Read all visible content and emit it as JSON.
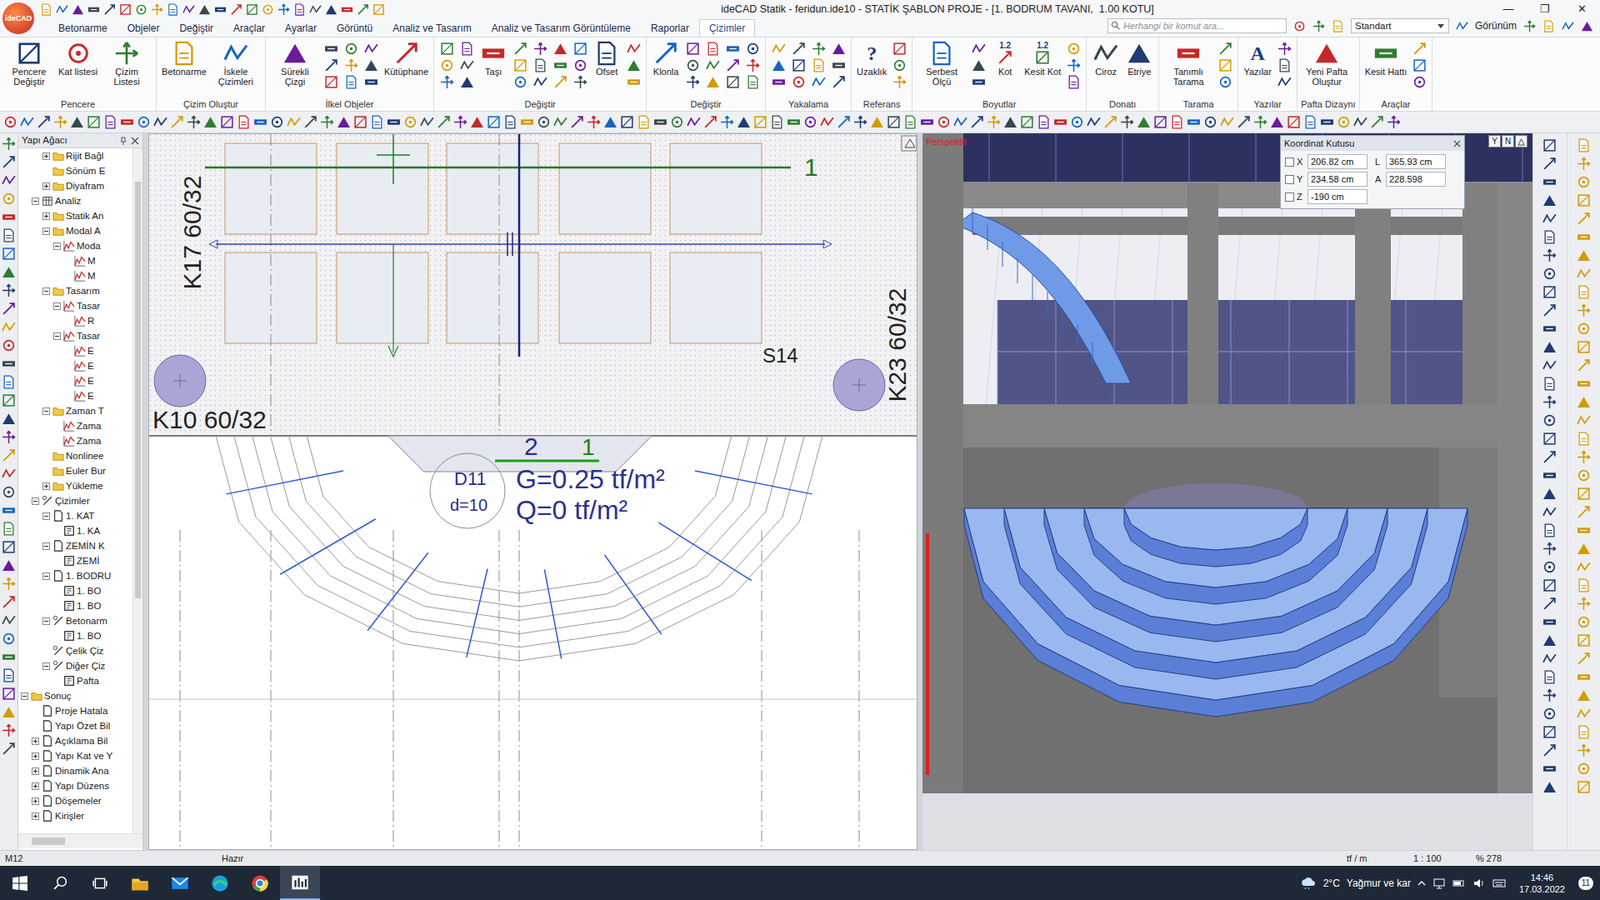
{
  "window": {
    "title": "ideCAD Statik - feridun.ide10 - STATİK ŞABLON PROJE - [1. BODRUM TAVANI,  1.00 KOTU]",
    "logo": "ideCAD",
    "controls": [
      "—",
      "❐",
      "✕"
    ]
  },
  "menu_tabs": [
    {
      "label": "Betonarme",
      "selected": false
    },
    {
      "label": "Objeler",
      "selected": false
    },
    {
      "label": "Değiştir",
      "selected": false
    },
    {
      "label": "Araçlar",
      "selected": false
    },
    {
      "label": "Ayarlar",
      "selected": false
    },
    {
      "label": "Görüntü",
      "selected": false
    },
    {
      "label": "Analiz ve Tasarım",
      "selected": false
    },
    {
      "label": "Analiz ve Tasarım Görüntüleme",
      "selected": false
    },
    {
      "label": "Raporlar",
      "selected": false
    },
    {
      "label": "Çizimler",
      "selected": true
    }
  ],
  "search": {
    "placeholder": "Herhangi bir komut ara..."
  },
  "style_select": "Standart",
  "view_menu": "Görünüm",
  "ribbon_groups": [
    {
      "title": "Pencere",
      "buttons": [
        {
          "label": "Pencere Değiştir"
        },
        {
          "label": "Kat listesi"
        },
        {
          "label": "Çizim Listesi"
        }
      ]
    },
    {
      "title": "Çizim Oluştur",
      "buttons": [
        {
          "label": "Betonarme"
        },
        {
          "label": "İskele Çizimleri"
        }
      ]
    },
    {
      "title": "İlkel Objeler",
      "buttons": [
        {
          "label": "Sürekli Çizgi"
        },
        {
          "label": "Kütüphane"
        }
      ]
    },
    {
      "title": "Değiştir",
      "buttons": [
        {
          "label": "Taşı"
        },
        {
          "label": "Ofset"
        }
      ]
    },
    {
      "title": "Değiştir",
      "buttons": [
        {
          "label": "Klonla"
        }
      ]
    },
    {
      "title": "Yakalama",
      "buttons": []
    },
    {
      "title": "Referans",
      "buttons": [
        {
          "label": "Uzaklık",
          "icon_text": "?"
        }
      ]
    },
    {
      "title": "Boyutlar",
      "buttons": [
        {
          "label": "Serbest Ölçü"
        },
        {
          "label": "Kot",
          "icon_text": "1.2"
        },
        {
          "label": "Kesit Kot",
          "icon_text": "1.2"
        }
      ]
    },
    {
      "title": "Donatı",
      "buttons": [
        {
          "label": "Ciroz"
        },
        {
          "label": "Etriye"
        }
      ]
    },
    {
      "title": "Tarama",
      "buttons": [
        {
          "label": "Tanımlı Tarama"
        }
      ]
    },
    {
      "title": "Yazılar",
      "buttons": [
        {
          "label": "Yazılar",
          "icon_text": "A"
        }
      ]
    },
    {
      "title": "Pafta Dizaynı",
      "buttons": [
        {
          "label": "Yeni Pafta Oluştur"
        }
      ]
    },
    {
      "title": "Araçlar",
      "buttons": [
        {
          "label": "Kesit Hattı"
        }
      ]
    }
  ],
  "tree": {
    "title": "Yapı Ağacı",
    "items": [
      {
        "label": "Rijit Bağl",
        "level": 2,
        "kind": "folder",
        "expandable": true,
        "expanded": false
      },
      {
        "label": "Sönüm E",
        "level": 2,
        "kind": "folder",
        "expandable": false,
        "expanded": false
      },
      {
        "label": "Diyafram",
        "level": 2,
        "kind": "folder",
        "expandable": true,
        "expanded": false
      },
      {
        "label": "Analiz",
        "level": 1,
        "kind": "analysis",
        "expandable": true,
        "expanded": true
      },
      {
        "label": "Statik An",
        "level": 2,
        "kind": "folder",
        "expandable": true,
        "expanded": false
      },
      {
        "label": "Modal A",
        "level": 2,
        "kind": "folder",
        "expandable": true,
        "expanded": true
      },
      {
        "label": "Moda",
        "level": 3,
        "kind": "chart",
        "expandable": true,
        "expanded": true
      },
      {
        "label": "M",
        "level": 4,
        "kind": "chart",
        "expandable": false,
        "expanded": false
      },
      {
        "label": "M",
        "level": 4,
        "kind": "chart",
        "expandable": false,
        "expanded": false
      },
      {
        "label": "Tasarım",
        "level": 2,
        "kind": "folder",
        "expandable": true,
        "expanded": true
      },
      {
        "label": "Tasar",
        "level": 3,
        "kind": "chart",
        "expandable": true,
        "expanded": true
      },
      {
        "label": "R",
        "level": 4,
        "kind": "chart",
        "expandable": false,
        "expanded": false
      },
      {
        "label": "Tasar",
        "level": 3,
        "kind": "chart",
        "expandable": true,
        "expanded": true
      },
      {
        "label": "E",
        "level": 4,
        "kind": "chart",
        "expandable": false,
        "expanded": false
      },
      {
        "label": "E",
        "level": 4,
        "kind": "chart",
        "expandable": false,
        "expanded": false
      },
      {
        "label": "E",
        "level": 4,
        "kind": "chart",
        "expandable": false,
        "expanded": false
      },
      {
        "label": "E",
        "level": 4,
        "kind": "chart",
        "expandable": false,
        "expanded": false
      },
      {
        "label": "Zaman T",
        "level": 2,
        "kind": "folder",
        "expandable": true,
        "expanded": true
      },
      {
        "label": "Zama",
        "level": 3,
        "kind": "chart",
        "expandable": false,
        "expanded": false
      },
      {
        "label": "Zama",
        "level": 3,
        "kind": "chart",
        "expandable": false,
        "expanded": false
      },
      {
        "label": "Nonlinee",
        "level": 2,
        "kind": "folder",
        "expandable": false,
        "expanded": false
      },
      {
        "label": "Euler Bur",
        "level": 2,
        "kind": "folder",
        "expandable": false,
        "expanded": false
      },
      {
        "label": "Yükleme",
        "level": 2,
        "kind": "folder",
        "expandable": true,
        "expanded": false
      },
      {
        "label": "Çizimler",
        "level": 1,
        "kind": "drawings",
        "expandable": true,
        "expanded": true
      },
      {
        "label": "1. KAT",
        "level": 2,
        "kind": "page",
        "expandable": true,
        "expanded": true
      },
      {
        "label": "1. KA",
        "level": 3,
        "kind": "sheet",
        "expandable": false,
        "expanded": false
      },
      {
        "label": "ZEMİN K",
        "level": 2,
        "kind": "page",
        "expandable": true,
        "expanded": true
      },
      {
        "label": "ZEMİ",
        "level": 3,
        "kind": "sheet",
        "expandable": false,
        "expanded": false
      },
      {
        "label": "1. BODRU",
        "level": 2,
        "kind": "page",
        "expandable": true,
        "expanded": true
      },
      {
        "label": "1. BO",
        "level": 3,
        "kind": "sheet",
        "expandable": false,
        "expanded": false
      },
      {
        "label": "1. BO",
        "level": 3,
        "kind": "sheet",
        "expandable": false,
        "expanded": false
      },
      {
        "label": "Betonarm",
        "level": 2,
        "kind": "drawings",
        "expandable": true,
        "expanded": true
      },
      {
        "label": "1. BO",
        "level": 3,
        "kind": "sheet",
        "expandable": false,
        "expanded": false
      },
      {
        "label": "Çelik Çiz",
        "level": 2,
        "kind": "drawings",
        "expandable": false,
        "expanded": false
      },
      {
        "label": "Diğer Çiz",
        "level": 2,
        "kind": "drawings",
        "expandable": true,
        "expanded": true
      },
      {
        "label": "Pafta",
        "level": 3,
        "kind": "sheet",
        "expandable": false,
        "expanded": false
      },
      {
        "label": "Sonuç",
        "level": 0,
        "kind": "folder",
        "expandable": true,
        "expanded": true
      },
      {
        "label": "Proje Hatala",
        "level": 1,
        "kind": "page",
        "expandable": false,
        "expanded": false
      },
      {
        "label": "Yapı Özet Bil",
        "level": 1,
        "kind": "page",
        "expandable": false,
        "expanded": false
      },
      {
        "label": "Açıklama Bil",
        "level": 1,
        "kind": "page",
        "expandable": true,
        "expanded": false
      },
      {
        "label": "Yapı Kat ve Y",
        "level": 1,
        "kind": "page",
        "expandable": true,
        "expanded": false
      },
      {
        "label": "Dinamik Ana",
        "level": 1,
        "kind": "page",
        "expandable": true,
        "expanded": false
      },
      {
        "label": "Yapı Düzens",
        "level": 1,
        "kind": "page",
        "expandable": true,
        "expanded": false
      },
      {
        "label": "Döşemeler",
        "level": 1,
        "kind": "page",
        "expandable": true,
        "expanded": false
      },
      {
        "label": "Kirişler",
        "level": 1,
        "kind": "page",
        "expandable": true,
        "expanded": false
      }
    ]
  },
  "plan": {
    "axis_top": "1",
    "column_labels": [
      "K17 60/32",
      "K10 60/32",
      "K23 60/32"
    ],
    "slab_label": "S14",
    "stair": {
      "step_no": "2",
      "axis": "1",
      "name": "D11",
      "thickness": "d=10",
      "dead_load": "G=0.25 tf/m²",
      "live_load": "Q=0 tf/m²"
    }
  },
  "view3d": {
    "label": "Perspektif",
    "view_buttons": [
      "Y",
      "N"
    ]
  },
  "coord_box": {
    "title": "Koordinat Kutusu",
    "fields": [
      {
        "axis": "X",
        "value": "206.82 cm",
        "checked": false
      },
      {
        "axis": "Y",
        "value": "234.58 cm",
        "checked": false
      },
      {
        "axis": "Z",
        "value": "-190 cm",
        "checked": false
      }
    ],
    "extra": [
      {
        "label": "L",
        "value": "365.93 cm"
      },
      {
        "label": "A",
        "value": "228.598"
      }
    ]
  },
  "status_bar": [
    "M12",
    "Hazır",
    "tf / m",
    "1 : 100",
    "% 278"
  ],
  "taskbar": {
    "apps": [
      {
        "selected": false
      },
      {
        "selected": false
      },
      {
        "selected": false
      },
      {
        "selected": false
      },
      {
        "selected": true
      }
    ],
    "temp": "2°C",
    "weather": "Yağmur ve kar",
    "time": "14:46",
    "date": "17.03.2022",
    "notifications": "11"
  }
}
